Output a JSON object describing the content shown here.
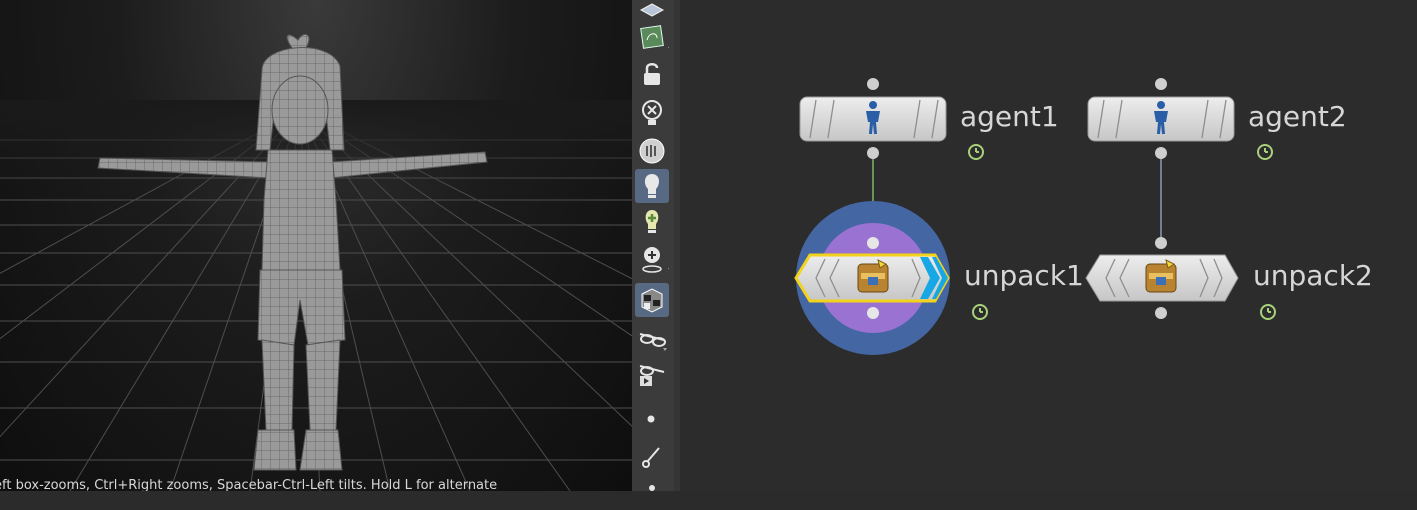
{
  "viewport": {
    "status_text": "eft box-zooms, Ctrl+Right zooms, Spacebar-Ctrl-Left tilts. Hold L for alternate"
  },
  "toolbar": {
    "items": [
      {
        "name": "display-options-icon",
        "active": false
      },
      {
        "name": "wireframe-toggle-icon",
        "active": false
      },
      {
        "name": "lock-camera-icon",
        "active": false
      },
      {
        "name": "hide-light-icon",
        "active": false
      },
      {
        "name": "headlight-icon",
        "active": false
      },
      {
        "name": "light-bulb-icon",
        "active": true
      },
      {
        "name": "add-light-icon",
        "active": false
      },
      {
        "name": "light-target-icon",
        "active": false
      },
      {
        "name": "shaded-cube-icon",
        "active": true
      },
      {
        "name": "visualize-glasses-icon",
        "active": false
      },
      {
        "name": "render-glasses-icon",
        "active": false
      },
      {
        "name": "point-icon",
        "active": false
      },
      {
        "name": "snap-hook-icon",
        "active": false
      }
    ]
  },
  "network": {
    "nodes": [
      {
        "id": "agent1",
        "label": "agent1",
        "type": "agent",
        "selected": false
      },
      {
        "id": "agent2",
        "label": "agent2",
        "type": "agent",
        "selected": false
      },
      {
        "id": "unpack1",
        "label": "unpack1",
        "type": "unpack",
        "selected": true,
        "display_flag": true
      },
      {
        "id": "unpack2",
        "label": "unpack2",
        "type": "unpack",
        "selected": false,
        "display_flag": false
      }
    ],
    "connections": [
      {
        "from": "agent1",
        "to": "unpack1"
      },
      {
        "from": "agent2",
        "to": "unpack2"
      }
    ],
    "colors": {
      "node_body": "#d9d9d9",
      "selected_outline": "#f2d21b",
      "display_flag": "#17a7e4",
      "ring_outer": "#4467a4",
      "ring_inner": "#9a72d2",
      "wire": "#7fb46a",
      "clock_badge": "#a9d17a"
    }
  }
}
